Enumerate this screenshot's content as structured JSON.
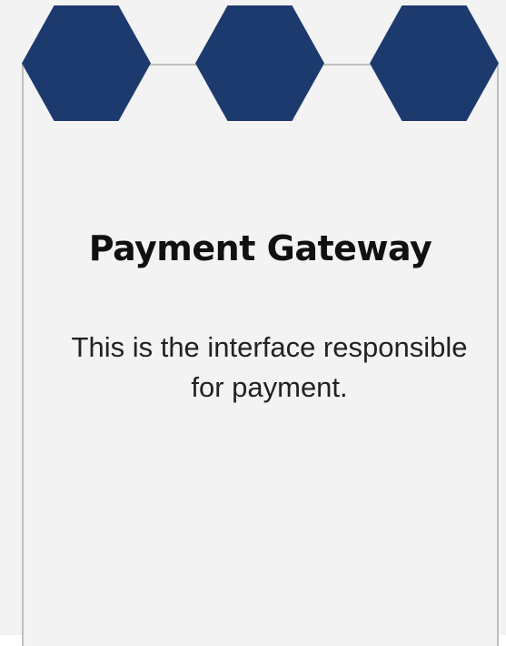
{
  "card": {
    "title": "Payment Gateway",
    "description": "This is the interface responsible for payment."
  },
  "decorations": {
    "hexagon_count": 3,
    "hexagon_color": "#1d3a6e",
    "border_color": "#bfbfbf",
    "background_color": "#f3f3f3"
  }
}
